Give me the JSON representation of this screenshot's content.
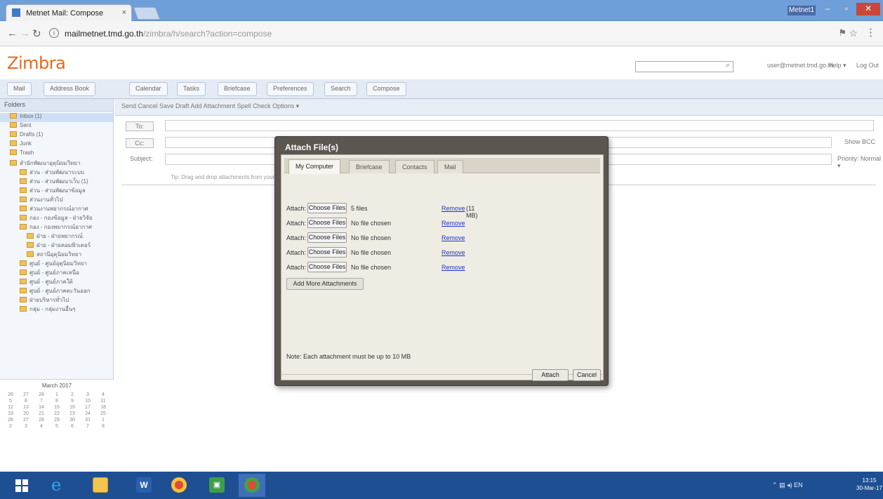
{
  "browser": {
    "tab_title": "Metnet Mail: Compose",
    "tab_close": "×",
    "url_host": "mailmetnet.tmd.go.th",
    "url_path": "/zimbra/h/search?action=compose",
    "window_user_label": "Metnet1"
  },
  "zimbra": {
    "logo": "Zimbra",
    "search_placeholder": "",
    "user_email": "user@metnet.tmd.go.th",
    "help": "Help ▾",
    "logout": "Log Out"
  },
  "app_tabs": [
    {
      "label": "Mail"
    },
    {
      "label": "Address Book"
    },
    {
      "label": "Calendar"
    },
    {
      "label": "Tasks"
    },
    {
      "label": "Briefcase"
    },
    {
      "label": "Preferences"
    },
    {
      "label": "Search"
    },
    {
      "label": "Compose"
    }
  ],
  "sidebar": {
    "folders_title": "Folders",
    "folders": [
      {
        "label": "Inbox (1)",
        "selected": true,
        "level": 0
      },
      {
        "label": "Sent",
        "level": 0
      },
      {
        "label": "Drafts (1)",
        "level": 0
      },
      {
        "label": "Junk",
        "level": 0
      },
      {
        "label": "Trash",
        "level": 0
      },
      {
        "label": "สำนักพัฒนาอุตุนิยมวิทยา",
        "level": 0
      },
      {
        "label": "ส่วน - ส่วนพัฒนาระบบ",
        "level": 1
      },
      {
        "label": "ส่วน - ส่วนพัฒนาเว็บ (1)",
        "level": 1
      },
      {
        "label": "ส่วน - ส่วนพัฒนาข้อมูล",
        "level": 1
      },
      {
        "label": "ส่วนงานทั่วไป",
        "level": 1
      },
      {
        "label": "ส่วนงานพยากรณ์อากาศ",
        "level": 1
      },
      {
        "label": "กอง - กองข้อมูล - ฝ่ายวิจัย",
        "level": 1
      },
      {
        "label": "กอง - กองพยากรณ์อากาศ",
        "level": 1
      },
      {
        "label": "ฝ่าย - ฝ่ายพยากรณ์",
        "level": 2
      },
      {
        "label": "ฝ่าย - ฝ่ายคอมพิวเตอร์",
        "level": 2
      },
      {
        "label": "สถานีอุตุนิยมวิทยา",
        "level": 2
      },
      {
        "label": "ศูนย์ - ศูนย์อุตุนิยมวิทยา",
        "level": 1
      },
      {
        "label": "ศูนย์ - ศูนย์ภาคเหนือ",
        "level": 1
      },
      {
        "label": "ศูนย์ - ศูนย์ภาคใต้",
        "level": 1
      },
      {
        "label": "ศูนย์ - ศูนย์ภาคตะวันออก",
        "level": 1
      },
      {
        "label": "ฝ่ายบริหารทั่วไป",
        "level": 1
      },
      {
        "label": "กลุ่ม - กลุ่มงานอื่นๆ",
        "level": 1
      }
    ],
    "calendar": {
      "month_label": "March 2017",
      "days": [
        "26",
        "27",
        "28",
        "1",
        "2",
        "3",
        "4",
        "5",
        "6",
        "7",
        "8",
        "9",
        "10",
        "11",
        "12",
        "13",
        "14",
        "15",
        "16",
        "17",
        "18",
        "19",
        "20",
        "21",
        "22",
        "23",
        "24",
        "25",
        "26",
        "27",
        "28",
        "29",
        "30",
        "31",
        "1",
        "2",
        "3",
        "4",
        "5",
        "6",
        "7",
        "8"
      ]
    }
  },
  "compose": {
    "toolbar": "Send   Cancel   Save Draft   Add Attachment   Spell Check   Options ▾",
    "to_label": "To:",
    "cc_label": "Cc:",
    "subject_label": "Subject:",
    "show_bcc": "Show BCC",
    "priority": "Priority: Normal ▾",
    "hint": "Tip: Drag and drop attachments from your computer"
  },
  "dialog": {
    "title": "Attach File(s)",
    "tabs": [
      {
        "label": "My Computer",
        "active": true
      },
      {
        "label": "Briefcase"
      },
      {
        "label": "Contacts"
      },
      {
        "label": "Mail"
      }
    ],
    "attach_label": "Attach:",
    "choose_files": "Choose Files",
    "rows": [
      {
        "file": "5 files",
        "remove": "Remove",
        "size": "(11 MB)"
      },
      {
        "file": "No file chosen",
        "remove": "Remove",
        "size": ""
      },
      {
        "file": "No file chosen",
        "remove": "Remove",
        "size": ""
      },
      {
        "file": "No file chosen",
        "remove": "Remove",
        "size": ""
      },
      {
        "file": "No file chosen",
        "remove": "Remove",
        "size": ""
      }
    ],
    "add_more": "Add More Attachments",
    "note": "Note: Each attachment must be up to 10 MB",
    "attach_button": "Attach",
    "cancel_button": "Cancel"
  },
  "taskbar": {
    "tray": "EN",
    "clock_time": "13:15",
    "clock_date": "30-Mar-17"
  },
  "colors": {
    "taskbar": "#1e4f93",
    "dialog_frame": "#5b5650",
    "zimbra_logo": "#e66a1a",
    "link": "#2233cc"
  }
}
